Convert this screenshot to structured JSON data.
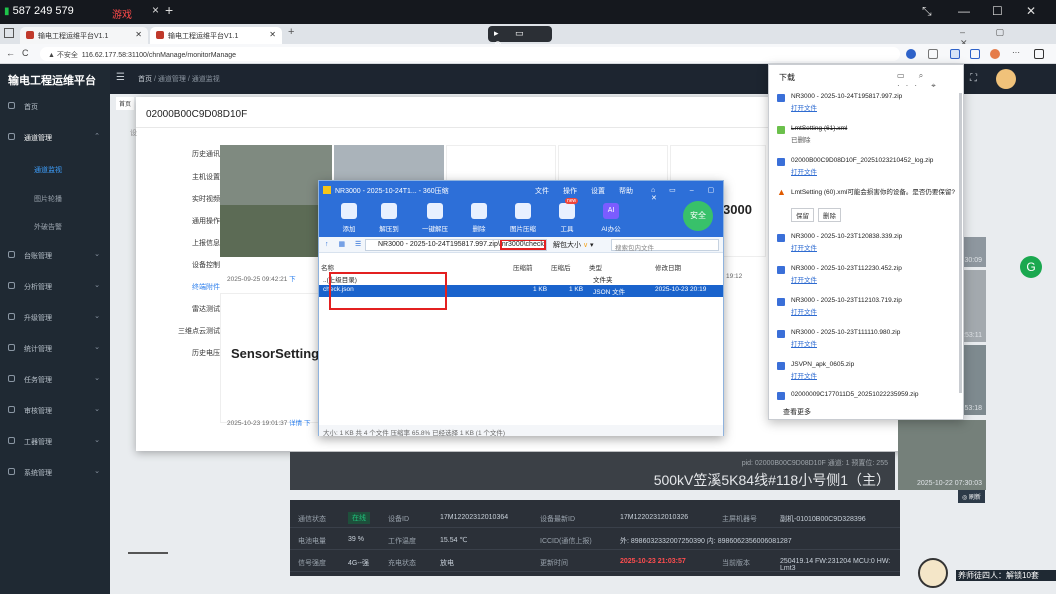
{
  "remote": {
    "phone": "587 249 579",
    "tab": "游戏",
    "tab_close": "×",
    "new_tab": "+"
  },
  "browser": {
    "tabs": [
      {
        "label": "输电工程运维平台V1.1"
      },
      {
        "label": "输电工程运维平台V1.1"
      }
    ],
    "security": "▲ 不安全",
    "url": "116.62.177.58:31100/chnManage/monitorManage",
    "media_controls": "▸ ▭ ⊗"
  },
  "app": {
    "logo": "输电工程运维平台",
    "breadcrumb": [
      "首页",
      "通道管理",
      "通道监视"
    ],
    "home_tab": "首页",
    "sidebar": [
      {
        "label": "首页",
        "icon": "home-icon"
      },
      {
        "label": "通道管理",
        "icon": "doc-icon",
        "arrow": "⌃"
      },
      {
        "label": "通道监视",
        "sub": true,
        "active": true
      },
      {
        "label": "图片轮播",
        "sub": true
      },
      {
        "label": "外破告警",
        "sub": true
      },
      {
        "label": "台账管理",
        "icon": "ledger-icon",
        "arrow": "⌄"
      },
      {
        "label": "分析管理",
        "icon": "analysis-icon",
        "arrow": "⌄"
      },
      {
        "label": "升级管理",
        "icon": "upgrade-icon",
        "arrow": "⌄"
      },
      {
        "label": "统计管理",
        "icon": "stats-icon",
        "arrow": "⌄"
      },
      {
        "label": "任务管理",
        "icon": "task-icon",
        "arrow": "⌄"
      },
      {
        "label": "审核管理",
        "icon": "audit-icon",
        "arrow": "⌄"
      },
      {
        "label": "工器管理",
        "icon": "tool-icon",
        "arrow": "⌄"
      },
      {
        "label": "系统管理",
        "icon": "system-icon",
        "arrow": "⌄"
      }
    ]
  },
  "modal": {
    "title": "02000B00C9D08D10F",
    "menu": [
      "历史通讯",
      "主机设置",
      "实时视频",
      "通用操作",
      "上报信息",
      "设备控制",
      "终端附件",
      "雷达测试",
      "三维点云测试",
      "历史电压"
    ],
    "active_menu": "终端附件",
    "big_label_visible": "3000",
    "sensor_title": "SensorSetting",
    "ts1": "2025-09-25 09:42:21",
    "ts1_link": "下",
    "ts2": "2025-10-23 19:01:37",
    "ts2_link": "详情 下",
    "ts3": "19:12",
    "side_tab": "设"
  },
  "zip": {
    "title": "NR3000 - 2025-10-24T1... - 360压缩",
    "menu": [
      "文件",
      "操作",
      "设置",
      "帮助"
    ],
    "toolbar": [
      "添加",
      "解压到",
      "一键解压",
      "删除",
      "图片压缩",
      "工具",
      "AI办公"
    ],
    "new_badge": "new",
    "ai_badge": "AI",
    "safe": "安全",
    "path_prefix": "NR3000 - 2025-10-24T195817.997.zip\\",
    "path_highlight": "nr3000\\check",
    "resize": "解包大小",
    "search_placeholder": "搜索包内文件",
    "columns": [
      "名称",
      "压缩前",
      "压缩后",
      "类型",
      "修改日期"
    ],
    "rows": [
      {
        "name": "..(上级目录)",
        "type": "文件夹"
      },
      {
        "name": "check.json",
        "before": "1 KB",
        "after": "1 KB",
        "type": "JSON 文件",
        "date": "2025-10-23 20:19",
        "selected": true
      }
    ],
    "status": "大小: 1 KB 共 4 个文件 压缩率 65.8% 已经选择 1 KB (1 个文件)"
  },
  "downloads": {
    "title": "下载",
    "items": [
      {
        "name": "NR3000 - 2025-10-24T195817.997.zip",
        "action": "打开文件"
      },
      {
        "name": "LmtSetting (61).xml",
        "action": "已删除",
        "deleted": true
      },
      {
        "name": "02000B00C9D08D10F_20251023210452_log.zip",
        "action": "打开文件"
      },
      {
        "name": "LmtSetting (60).xml可能会损害你的设备。是否仍要保留?",
        "warn": true,
        "buttons": [
          "保留",
          "删除"
        ]
      },
      {
        "name": "NR3000 - 2025-10-23T120838.339.zip",
        "action": "打开文件"
      },
      {
        "name": "NR3000 - 2025-10-23T112230.452.zip",
        "action": "打开文件"
      },
      {
        "name": "NR3000 - 2025-10-23T112103.719.zip",
        "action": "打开文件"
      },
      {
        "name": "NR3000 - 2025-10-23T111110.980.zip",
        "action": "打开文件"
      },
      {
        "name": "JSVPN_apk_0605.zip",
        "action": "打开文件"
      },
      {
        "name": "02000009C177011D5_20251022235959.zip"
      }
    ],
    "more": "查看更多"
  },
  "video": {
    "small": "pid: 02000B00C9D08D10F 通道: 1 预置位: 255",
    "big": "500kV笠溪5K84线#118小号侧1（主）"
  },
  "right_thumbs": [
    {
      "time": "07:30:09"
    },
    {
      "time": "00:53:11"
    },
    {
      "time": "2:53:18"
    },
    {
      "time": "2025-10-22 07:30:03"
    }
  ],
  "refresh": "◎ 刷新",
  "info": [
    {
      "cells": [
        "通信状态",
        "在线",
        "设备ID",
        "17M12202312010364",
        "设备最新ID",
        "17M12202312010326",
        "主屏机器号",
        "副机-01010B00C9D328396"
      ]
    },
    {
      "cells": [
        "电池电量",
        "39 %",
        "工作温度",
        "15.54 ℃",
        "ICCID(通信上报)",
        "外: 8986032332007250390 内: 8986062356006081287",
        "",
        ""
      ]
    },
    {
      "cells": [
        "信号强度",
        "4G--强",
        "充电状态",
        "放电",
        "更新时间",
        "2025-10-23 21:03:57",
        "当前版本",
        "250419.14 FW:231204 MCU:0 HW: Lmt3"
      ]
    }
  ],
  "chat_overlay": "养师徒四人：解锁10套"
}
